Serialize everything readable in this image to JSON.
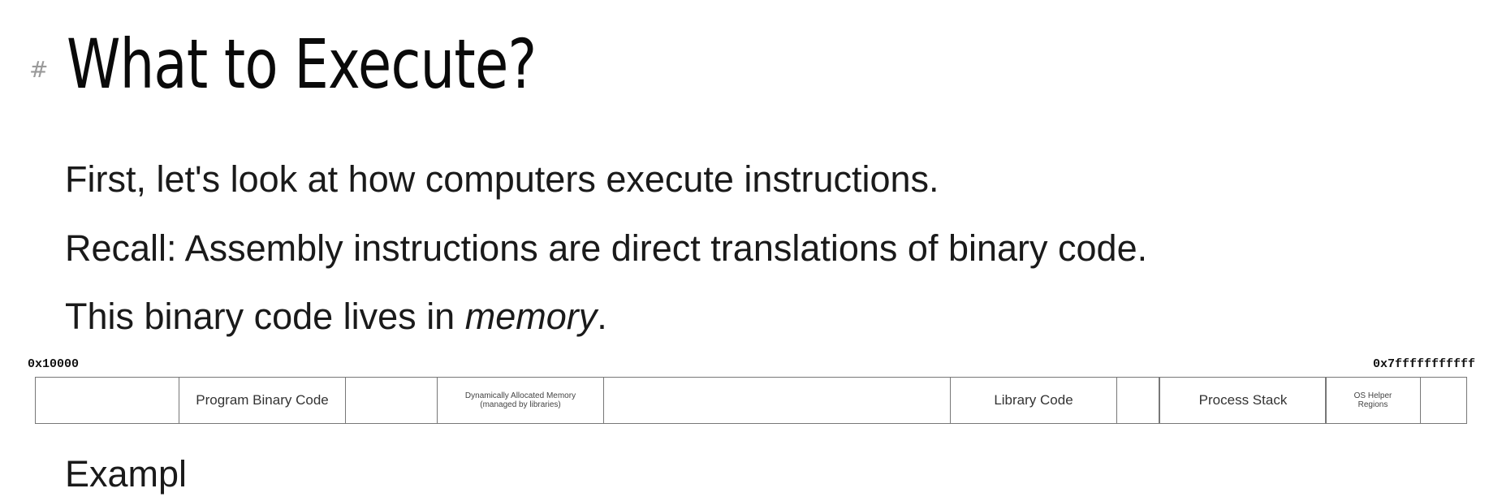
{
  "heading": {
    "hash": "#",
    "title": "What to Execute?"
  },
  "paragraphs": {
    "line1": "First, let's look at how computers execute instructions.",
    "line2": "Recall: Assembly instructions are direct translations of binary code.",
    "line3_prefix": "This binary code lives in ",
    "line3_emphasis": "memory",
    "line3_suffix": "."
  },
  "memory_map": {
    "start_address": "0x10000",
    "end_address": "0x7fffffffffff",
    "segments": {
      "program": "Program Binary Code",
      "dynamic_line1": "Dynamically Allocated Memory",
      "dynamic_line2": "(managed by libraries)",
      "library": "Library Code",
      "stack": "Process Stack",
      "os_line1": "OS Helper",
      "os_line2": "Regions"
    }
  },
  "cut_off_text": "Exampl"
}
